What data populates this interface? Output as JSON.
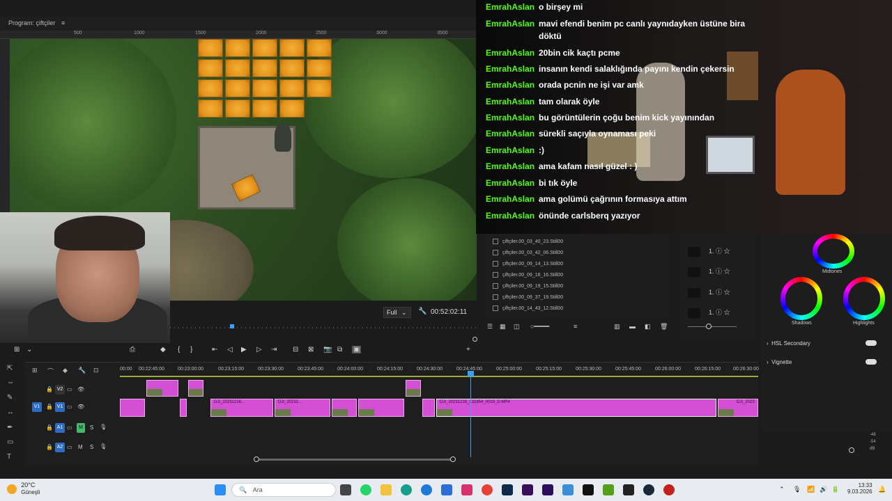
{
  "program": {
    "title": "Program: çiftçiler",
    "ruler_ticks": [
      "500",
      "1000",
      "1500",
      "2000",
      "2500",
      "3000",
      "3500"
    ],
    "fit": "Full",
    "timecode": "00:52:02:11"
  },
  "chat": {
    "messages": [
      {
        "user": "EmrahAslan",
        "text": "o birşey mi"
      },
      {
        "user": "EmrahAslan",
        "text": "mavi efendi benim pc canlı yaynıdayken üstüne bira döktü"
      },
      {
        "user": "EmrahAslan",
        "text": "20bin cik kaçtı pcme"
      },
      {
        "user": "EmrahAslan",
        "text": "insanın kendi salaklığında payını kendin çekersin"
      },
      {
        "user": "EmrahAslan",
        "text": "orada pcnin ne işi var amk"
      },
      {
        "user": "EmrahAslan",
        "text": "tam olarak öyle"
      },
      {
        "user": "EmrahAslan",
        "text": "bu görüntülerin çoğu benim kick yayınından"
      },
      {
        "user": "EmrahAslan",
        "text": "sürekli saçıyla oynaması peki"
      },
      {
        "user": "EmrahAslan",
        "text": ":)"
      },
      {
        "user": "EmrahAslan",
        "text": "ama kafam nasıl güzel : )"
      },
      {
        "user": "EmrahAslan",
        "text": "bi tık öyle"
      },
      {
        "user": "EmrahAslan",
        "text": "ama golümü çağrının formasıya attım"
      },
      {
        "user": "EmrahAslan",
        "text": "önünde carlsberq yazıyor"
      }
    ]
  },
  "bin": {
    "items": [
      "çiftçiler.00_03_40_23.Still00",
      "çiftçiler.00_03_42_06.Still00",
      "çiftçiler.00_09_14_13.Still00",
      "çiftçiler.00_09_16_16.Still00",
      "çiftçiler.00_09_19_15.Still00",
      "çiftçiler.00_09_37_19.Still00",
      "çiftçiler.00_14_43_12.Still00"
    ]
  },
  "fx": {
    "rows": [
      "1.",
      "1.",
      "1.",
      "1."
    ]
  },
  "lumetri": {
    "wheels": {
      "midtones": "Midtones",
      "shadows": "Shadows",
      "highlights": "Highlights"
    },
    "sections": [
      "HSL Secondary",
      "Vignette"
    ]
  },
  "timeline": {
    "timecodes": [
      "00:00",
      "00:22:45:00",
      "00:23:00:00",
      "00:23:15:00",
      "00:23:30:00",
      "00:23:45:00",
      "00:24:00:00",
      "00:24:15:00",
      "00:24:30:00",
      "00:24:45:00",
      "00:25:00:00",
      "00:25:15:00",
      "00:25:30:00",
      "00:25:45:00",
      "00:26:00:00",
      "00:26:15:00",
      "00:26:30:00"
    ],
    "tracks": {
      "v2": "V2",
      "v1": "V1",
      "a1": "A1",
      "a2": "A2",
      "m": "M",
      "s": "S",
      "source_v1": "V1",
      "source_a1": "A1"
    },
    "clip_names": [
      "DJI_20231216...",
      "DJI_20231...",
      "DJI_20231216_131854_0015_D.MP4",
      "DJI_2023"
    ]
  },
  "taskbar": {
    "weather_temp": "20°C",
    "weather_desc": "Güneşli",
    "search_placeholder": "Ara",
    "time": "13:33",
    "date": "9.03.2026"
  }
}
